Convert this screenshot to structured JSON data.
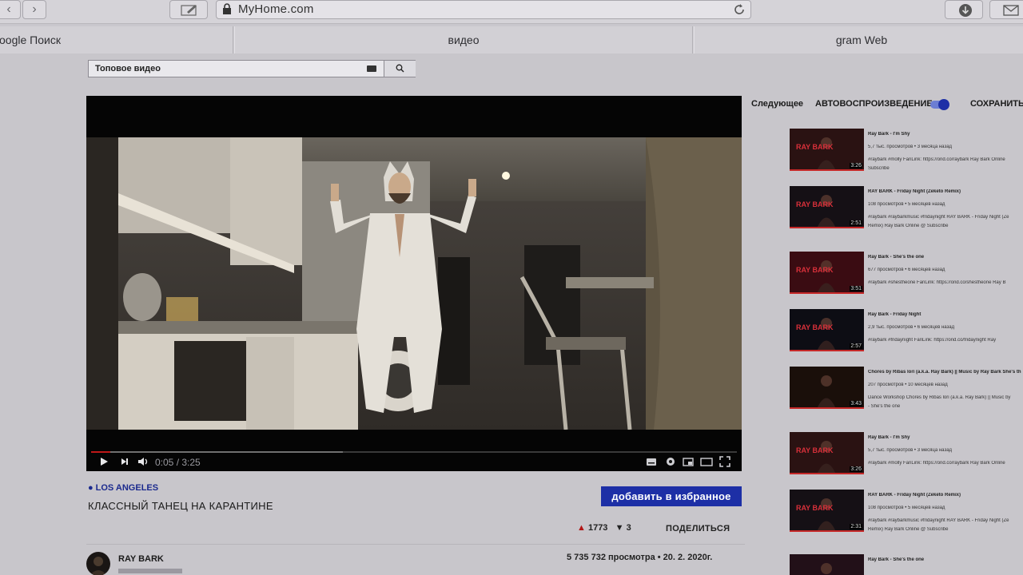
{
  "browser": {
    "url": "MyHome.com",
    "tabs": [
      "oogle Поиск",
      "видео",
      "gram Web"
    ]
  },
  "search": {
    "value": "Топовое видео",
    "placeholder": ""
  },
  "player": {
    "time": "0:05 / 3:25",
    "progress_played": 0.03,
    "progress_loaded": 0.39
  },
  "video": {
    "location": "LOS ANGELES",
    "title": "КЛАССНЫЙ ТАНЕЦ НА КАРАНТИНЕ",
    "favorite_label": "добавить в избранное",
    "likes": "1773",
    "dislikes": "3",
    "share_label": "ПОДЕЛИТЬСЯ",
    "channel": "RAY BARK",
    "views_date": "5 735 732 просмотра • 20. 2. 2020г."
  },
  "sidebar": {
    "next_label": "Следующее",
    "autoplay_label": "АВТОВОСПРОИЗВЕДЕНИЕ",
    "save_label": "СОХРАНИТЬ",
    "items": [
      {
        "title": "Ray Bark - I'm Shy",
        "meta": "5,7 тыс. просмотров • 3 месяца назад",
        "desc": "#raybark #molly FanLink: https://ond.co/raybark Ray Bark Online",
        "desc2": "Subscribe",
        "duration": "3:26",
        "thumb": "RAY BARK"
      },
      {
        "title": "RAY BARK - Friday Night (Zeketo Remix)",
        "meta": "108 просмотров • 5 месяцев назад",
        "desc": "#raybark #raybarkmusic #fridaynight RAY BARK - Friday Night (Ze",
        "desc2": "Remix) Ray Bark Online @ Subscribe",
        "duration": "2:51",
        "thumb": "RAY BARK"
      },
      {
        "title": "Ray Bark - She's the one",
        "meta": "677 просмотров • 6 месяцев назад",
        "desc": "#raybark #shestheone FanLink: https://ond.co/shestheone Ray B",
        "desc2": "",
        "duration": "3:51",
        "thumb": "RAY BARK"
      },
      {
        "title": "Ray Bark - Friday Night",
        "meta": "2,9 тыс. просмотров • 6 месяцев назад",
        "desc": "#raybark #fridaynight FanLink: https://ond.co/fridaynight Ray",
        "desc2": "",
        "duration": "2:57",
        "thumb": "RAY BARK"
      },
      {
        "title": "Chores by Ribas lori (a.k.a. Ray Bark) || Music by Ray Bark She's th",
        "meta": "207 просмотров • 10 месяцев назад",
        "desc": "Dance Workshop Chores by Ribas lori (a.k.a. Ray Bark) || Music by",
        "desc2": "- She's the one",
        "duration": "3:43",
        "thumb": ""
      },
      {
        "title": "Ray Bark - I'm Shy",
        "meta": "5,7 тыс. просмотров • 3 месяца назад",
        "desc": "#raybark #molly FanLink: https://ond.co/raybark Ray Bark Online",
        "desc2": "",
        "duration": "3:26",
        "thumb": "RAY BARK"
      },
      {
        "title": "RAY BARK - Friday Night (Zeketo Remix)",
        "meta": "108 просмотров • 5 месяцев назад",
        "desc": "#raybark #raybarkmusic #fridaynight RAY BARK - Friday Night (Ze",
        "desc2": "Remix) Ray Bark Online @ Subscribe",
        "duration": "2:31",
        "thumb": "RAY BARK"
      },
      {
        "title": "Ray Bark - She's the one",
        "meta": "",
        "desc": "",
        "desc2": "",
        "duration": "",
        "thumb": ""
      }
    ]
  }
}
